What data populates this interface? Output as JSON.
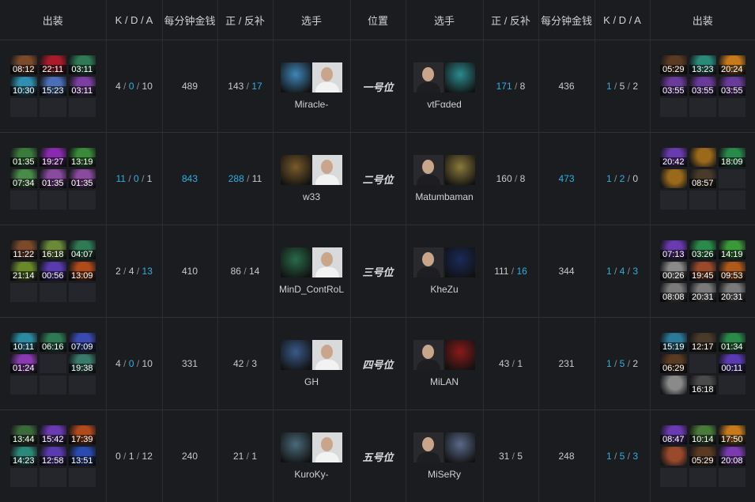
{
  "header": {
    "items_left": "出装",
    "kda_left": "K / D / A",
    "gpm_left": "每分钟金钱",
    "lhdn_left": "正 / 反补",
    "player_left": "选手",
    "position": "位置",
    "player_right": "选手",
    "lhdn_right": "正 / 反补",
    "gpm_right": "每分钟金钱",
    "kda_right": "K / D / A",
    "items_right": "出装"
  },
  "rows": [
    {
      "left": {
        "items": [
          {
            "time": "08:12",
            "color": "#7a4a2a"
          },
          {
            "time": "22:11",
            "color": "#a81c2a"
          },
          {
            "time": "03:11",
            "color": "#2f7a55"
          },
          {
            "time": "10:30",
            "color": "#2e8fb0"
          },
          {
            "time": "15:23",
            "color": "#4a6fb8"
          },
          {
            "time": "03:11",
            "color": "#7a3fa0"
          },
          {
            "time": "",
            "color": ""
          },
          {
            "time": "",
            "color": ""
          },
          {
            "time": "",
            "color": ""
          }
        ],
        "k": "4",
        "d": "0",
        "a": "10",
        "gpm": "489",
        "lh": "143",
        "dn": "17",
        "player": "Miracle-",
        "hero_color": "#3f86b8"
      },
      "position": "一号位",
      "right": {
        "player": "vtFαded",
        "hero_color": "#2c8a8f",
        "lh": "171",
        "dn": "8",
        "gpm": "436",
        "k": "1",
        "d": "5",
        "a": "2",
        "items": [
          {
            "time": "05:29",
            "color": "#5a3a22"
          },
          {
            "time": "13:23",
            "color": "#2a8a7a"
          },
          {
            "time": "20:24",
            "color": "#c87a1a"
          },
          {
            "time": "03:55",
            "color": "#6a3a9a"
          },
          {
            "time": "03:55",
            "color": "#6a3a9a"
          },
          {
            "time": "03:55",
            "color": "#6a3a9a"
          },
          {
            "time": "",
            "color": ""
          },
          {
            "time": "",
            "color": ""
          },
          {
            "time": "",
            "color": ""
          }
        ]
      }
    },
    {
      "left": {
        "items": [
          {
            "time": "01:35",
            "color": "#3a7a3a"
          },
          {
            "time": "19:27",
            "color": "#8a2ab0"
          },
          {
            "time": "13:19",
            "color": "#3a8a3a"
          },
          {
            "time": "07:34",
            "color": "#4a8a4a"
          },
          {
            "time": "01:35",
            "color": "#8a4aa0"
          },
          {
            "time": "01:35",
            "color": "#8a4aa0"
          },
          {
            "time": "",
            "color": ""
          },
          {
            "time": "",
            "color": ""
          },
          {
            "time": "",
            "color": ""
          }
        ],
        "k": "11",
        "d": "0",
        "a": "1",
        "gpm": "843",
        "lh": "288",
        "dn": "11",
        "player": "w33",
        "hero_color": "#7a5a2a"
      },
      "position": "二号位",
      "right": {
        "player": "Matumbaman",
        "hero_color": "#8a7a3a",
        "lh": "160",
        "dn": "8",
        "gpm": "473",
        "k": "1",
        "d": "2",
        "a": "0",
        "items": [
          {
            "time": "20:42",
            "color": "#6a3ab0"
          },
          {
            "time": "",
            "color": "#9a6a1a"
          },
          {
            "time": "18:09",
            "color": "#2a8a4a"
          },
          {
            "time": "",
            "color": "#9a6a1a"
          },
          {
            "time": "08:57",
            "color": "#4a3a2a"
          },
          {
            "time": "",
            "color": ""
          },
          {
            "time": "",
            "color": ""
          },
          {
            "time": "",
            "color": ""
          },
          {
            "time": "",
            "color": ""
          }
        ]
      }
    },
    {
      "left": {
        "items": [
          {
            "time": "11:22",
            "color": "#7a4a2a"
          },
          {
            "time": "16:18",
            "color": "#6a8a3a"
          },
          {
            "time": "04:07",
            "color": "#2f7a55"
          },
          {
            "time": "21:14",
            "color": "#6a8a2a"
          },
          {
            "time": "00:56",
            "color": "#5a3ab0"
          },
          {
            "time": "13:09",
            "color": "#b04a1a"
          },
          {
            "time": "",
            "color": ""
          },
          {
            "time": "",
            "color": ""
          },
          {
            "time": "",
            "color": ""
          }
        ],
        "k": "2",
        "d": "4",
        "a": "13",
        "gpm": "410",
        "lh": "86",
        "dn": "14",
        "player": "MinD_ContRoL",
        "hero_color": "#2a6a4a"
      },
      "position": "三号位",
      "right": {
        "player": "KheZu",
        "hero_color": "#1a2a5a",
        "lh": "111",
        "dn": "16",
        "gpm": "344",
        "k": "1",
        "d": "4",
        "a": "3",
        "items": [
          {
            "time": "07:13",
            "color": "#6a3ab0"
          },
          {
            "time": "03:26",
            "color": "#2a8a4a"
          },
          {
            "time": "14:19",
            "color": "#3a9a3a"
          },
          {
            "time": "00:26",
            "color": "#8a8a8a"
          },
          {
            "time": "19:45",
            "color": "#9a4a2a"
          },
          {
            "time": "09:53",
            "color": "#b05a1a"
          },
          {
            "time": "08:08",
            "color": "#7a7a7a"
          },
          {
            "time": "20:31",
            "color": "#7a7a7a"
          },
          {
            "time": "20:31",
            "color": "#7a7a7a"
          }
        ]
      }
    },
    {
      "left": {
        "items": [
          {
            "time": "10:11",
            "color": "#2a8aa0"
          },
          {
            "time": "06:16",
            "color": "#2f7a55"
          },
          {
            "time": "07:09",
            "color": "#3a4ab0"
          },
          {
            "time": "01:24",
            "color": "#8a3ab0"
          },
          {
            "time": "",
            "color": ""
          },
          {
            "time": "19:38",
            "color": "#3a7a6a"
          },
          {
            "time": "",
            "color": ""
          },
          {
            "time": "",
            "color": ""
          },
          {
            "time": "",
            "color": ""
          }
        ],
        "k": "4",
        "d": "0",
        "a": "10",
        "gpm": "331",
        "lh": "42",
        "dn": "3",
        "player": "GH",
        "hero_color": "#3a5a8a"
      },
      "position": "四号位",
      "right": {
        "player": "MiLAN",
        "hero_color": "#8a1a1a",
        "lh": "43",
        "dn": "1",
        "gpm": "231",
        "k": "1",
        "d": "5",
        "a": "2",
        "items": [
          {
            "time": "15:19",
            "color": "#2a7a9a"
          },
          {
            "time": "12:17",
            "color": "#4a3a2a"
          },
          {
            "time": "01:34",
            "color": "#2a8a4a"
          },
          {
            "time": "06:29",
            "color": "#5a3a22"
          },
          {
            "time": "",
            "color": ""
          },
          {
            "time": "00:11",
            "color": "#5a3ab0"
          },
          {
            "time": "",
            "color": "#8a8a8a"
          },
          {
            "time": "16:18",
            "color": "#4a4a4a"
          },
          {
            "time": "",
            "color": ""
          }
        ]
      }
    },
    {
      "left": {
        "items": [
          {
            "time": "13:44",
            "color": "#3a6a3a"
          },
          {
            "time": "15:42",
            "color": "#6a3ab0"
          },
          {
            "time": "17:39",
            "color": "#b04a1a"
          },
          {
            "time": "14:23",
            "color": "#2a8a7a"
          },
          {
            "time": "12:58",
            "color": "#5a3ab0"
          },
          {
            "time": "13:51",
            "color": "#2a4ab0"
          },
          {
            "time": "",
            "color": ""
          },
          {
            "time": "",
            "color": ""
          },
          {
            "time": "",
            "color": ""
          }
        ],
        "k": "0",
        "d": "1",
        "a": "12",
        "gpm": "240",
        "lh": "21",
        "dn": "1",
        "player": "KuroKy-",
        "hero_color": "#4a6a7a"
      },
      "position": "五号位",
      "right": {
        "player": "MiSeRy",
        "hero_color": "#5a6a8a",
        "lh": "31",
        "dn": "5",
        "gpm": "248",
        "k": "1",
        "d": "5",
        "a": "3",
        "items": [
          {
            "time": "08:47",
            "color": "#6a3ab0"
          },
          {
            "time": "10:14",
            "color": "#4a7a3a"
          },
          {
            "time": "17:50",
            "color": "#c87a1a"
          },
          {
            "time": "",
            "color": "#9a4a2a"
          },
          {
            "time": "05:29",
            "color": "#5a3a22"
          },
          {
            "time": "20:08",
            "color": "#7a3ab0"
          },
          {
            "time": "",
            "color": ""
          },
          {
            "time": "",
            "color": ""
          },
          {
            "time": "",
            "color": ""
          }
        ]
      }
    }
  ],
  "highlight_color": "#2bb1e2"
}
